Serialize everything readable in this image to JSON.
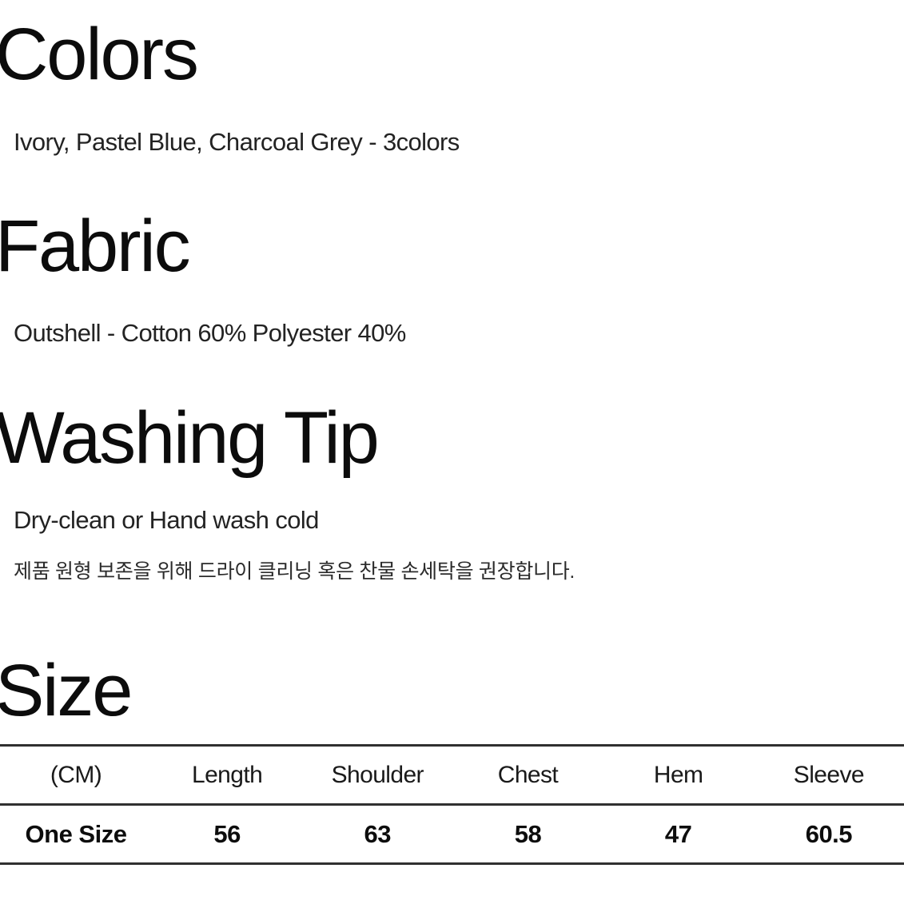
{
  "sections": {
    "colors": {
      "heading": "Colors",
      "text": "Ivory, Pastel Blue, Charcoal Grey - 3colors"
    },
    "fabric": {
      "heading": "Fabric",
      "text": "Outshell - Cotton 60%  Polyester 40%"
    },
    "washing": {
      "heading": "Washing Tip",
      "text_en": "Dry-clean or Hand wash cold",
      "text_ko": "제품 원형 보존을 위해 드라이 클리닝 혹은 찬물 손세탁을 권장합니다."
    },
    "size": {
      "heading": "Size",
      "table": {
        "headers": [
          "(CM)",
          "Length",
          "Shoulder",
          "Chest",
          "Hem",
          "Sleeve"
        ],
        "rows": [
          [
            "One Size",
            "56",
            "63",
            "58",
            "47",
            "60.5"
          ]
        ]
      }
    }
  },
  "colors": {
    "background": "#ffffff",
    "heading_text": "#0c0c0c",
    "body_text": "#232323",
    "table_rule": "#303030"
  }
}
